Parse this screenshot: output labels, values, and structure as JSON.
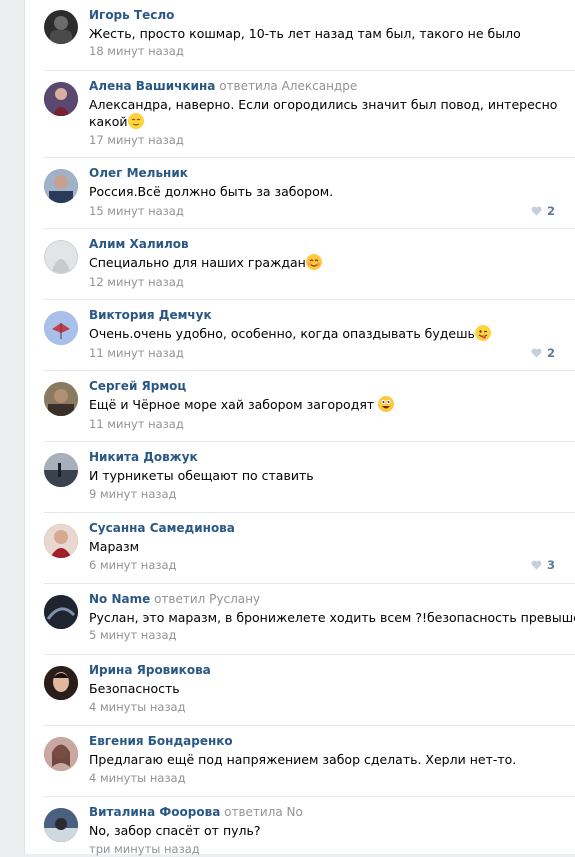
{
  "colors": {
    "author": "#2a5885",
    "meta": "#939393",
    "like": "#5c7a99",
    "separator": "#e7e8ec"
  },
  "comments": [
    {
      "author": "Игорь Тесло",
      "reply_to": "",
      "text": "Жесть, просто кошмар, 10-ть лет назад там был, такого не было",
      "text2": "",
      "emoji": "",
      "time": "18 минут назад",
      "likes": "",
      "avatar_color": "#2c2c2c"
    },
    {
      "author": "Алена Вашичкина",
      "reply_to": "ответила Александре",
      "text": "Александра, наверно. Если огородились значит был повод, интересно",
      "text2": "какой",
      "emoji": "relieved-emoji",
      "time": "17 минут назад",
      "likes": "",
      "avatar_color": "#4a3a5a"
    },
    {
      "author": "Олег Мельник",
      "reply_to": "",
      "text": "Россия.Всё должно быть за забором.",
      "text2": "",
      "emoji": "",
      "time": "15 минут назад",
      "likes": "2",
      "avatar_color": "#6a7c96"
    },
    {
      "author": "Алим Халилов",
      "reply_to": "",
      "text": "Специально для наших граждан",
      "text2": "",
      "emoji": "smile-emoji",
      "time": "12 минут назад",
      "likes": "",
      "avatar_color": "#d7d8da"
    },
    {
      "author": "Виктория Демчук",
      "reply_to": "",
      "text": "Очень.очень удобно, особенно, когда опаздывать будешь",
      "text2": "",
      "emoji": "wink-tongue-emoji",
      "time": "11 минут назад",
      "likes": "2",
      "avatar_color": "#8fa8d8"
    },
    {
      "author": "Сергей Ярмоц",
      "reply_to": "",
      "text": "Ещё и Чёрное море хай забором загородят ",
      "text2": "",
      "emoji": "grin-emoji",
      "time": "11 минут назад",
      "likes": "",
      "avatar_color": "#7a6a55"
    },
    {
      "author": "Никита Довжук",
      "reply_to": "",
      "text": "И турникеты обещают по ставить",
      "text2": "",
      "emoji": "",
      "time": "9 минут назад",
      "likes": "",
      "avatar_color": "#5a6070"
    },
    {
      "author": "Сусанна Самединова",
      "reply_to": "",
      "text": "Маразм",
      "text2": "",
      "emoji": "",
      "time": "6 минут назад",
      "likes": "3",
      "avatar_color": "#8a4a4a"
    },
    {
      "author": "No Name",
      "reply_to": "ответил Руслану",
      "text": "Руслан, это маразм, в бронижелете ходить всем ?!безопасность превыше",
      "text2": "",
      "emoji": "",
      "time": "5 минут назад",
      "likes": "",
      "avatar_color": "#2a3040"
    },
    {
      "author": "Ирина Яровикова",
      "reply_to": "",
      "text": "Безопасность",
      "text2": "",
      "emoji": "",
      "time": "4 минуты назад",
      "likes": "",
      "avatar_color": "#3a2a25"
    },
    {
      "author": "Евгения Бондаренко",
      "reply_to": "",
      "text": "Предлагаю ещё под напряжением забор сделать. Херли нет-то.",
      "text2": "",
      "emoji": "",
      "time": "4 минуты назад",
      "likes": "",
      "avatar_color": "#9a6a60"
    },
    {
      "author": "Виталина Фоорова",
      "reply_to": "ответила No",
      "text": "No, забор спасёт от пуль?",
      "text2": "",
      "emoji": "",
      "time": "три минуты назад",
      "likes": "",
      "avatar_color": "#3a4a60"
    }
  ]
}
